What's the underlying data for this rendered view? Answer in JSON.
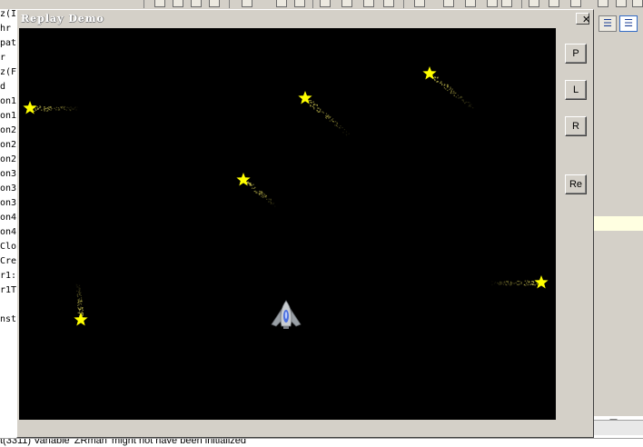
{
  "ide": {
    "left_panel_lines": [
      "z(I",
      "hr",
      "pat",
      "r",
      "z(F",
      "d",
      "on1",
      "on1",
      "on2",
      "on2",
      "on2",
      "on3",
      "on3",
      "on3",
      "on4",
      "on4",
      "Clo",
      "Cre",
      "r1:",
      "r1T",
      "",
      "nst"
    ],
    "right_toolbar": {
      "align_left_icon": "align-left-icon",
      "align_center_icon": "align-center-icon"
    },
    "right_panel_dash": "—",
    "status_text": "t(3311) Variable 'ZRman' might not have been initialized"
  },
  "window": {
    "title": "Replay Demo",
    "close_label": "✕"
  },
  "controls": {
    "pause_label": "P",
    "left_label": "L",
    "right_label": "R",
    "restart_label": "Re"
  },
  "game": {
    "background_color": "#000000",
    "star_color": "#ffff00",
    "trail_color": "#b8b04a",
    "ship_icon": "spaceship-icon",
    "star_icon": "star-icon",
    "comets": [
      {
        "id": 1,
        "direction": "down-right"
      },
      {
        "id": 2,
        "direction": "down-right"
      },
      {
        "id": 3,
        "direction": "down-right"
      },
      {
        "id": 4,
        "direction": "down-right"
      },
      {
        "id": 5,
        "direction": "right"
      },
      {
        "id": 6,
        "direction": "left"
      },
      {
        "id": 7,
        "direction": "down"
      }
    ]
  }
}
